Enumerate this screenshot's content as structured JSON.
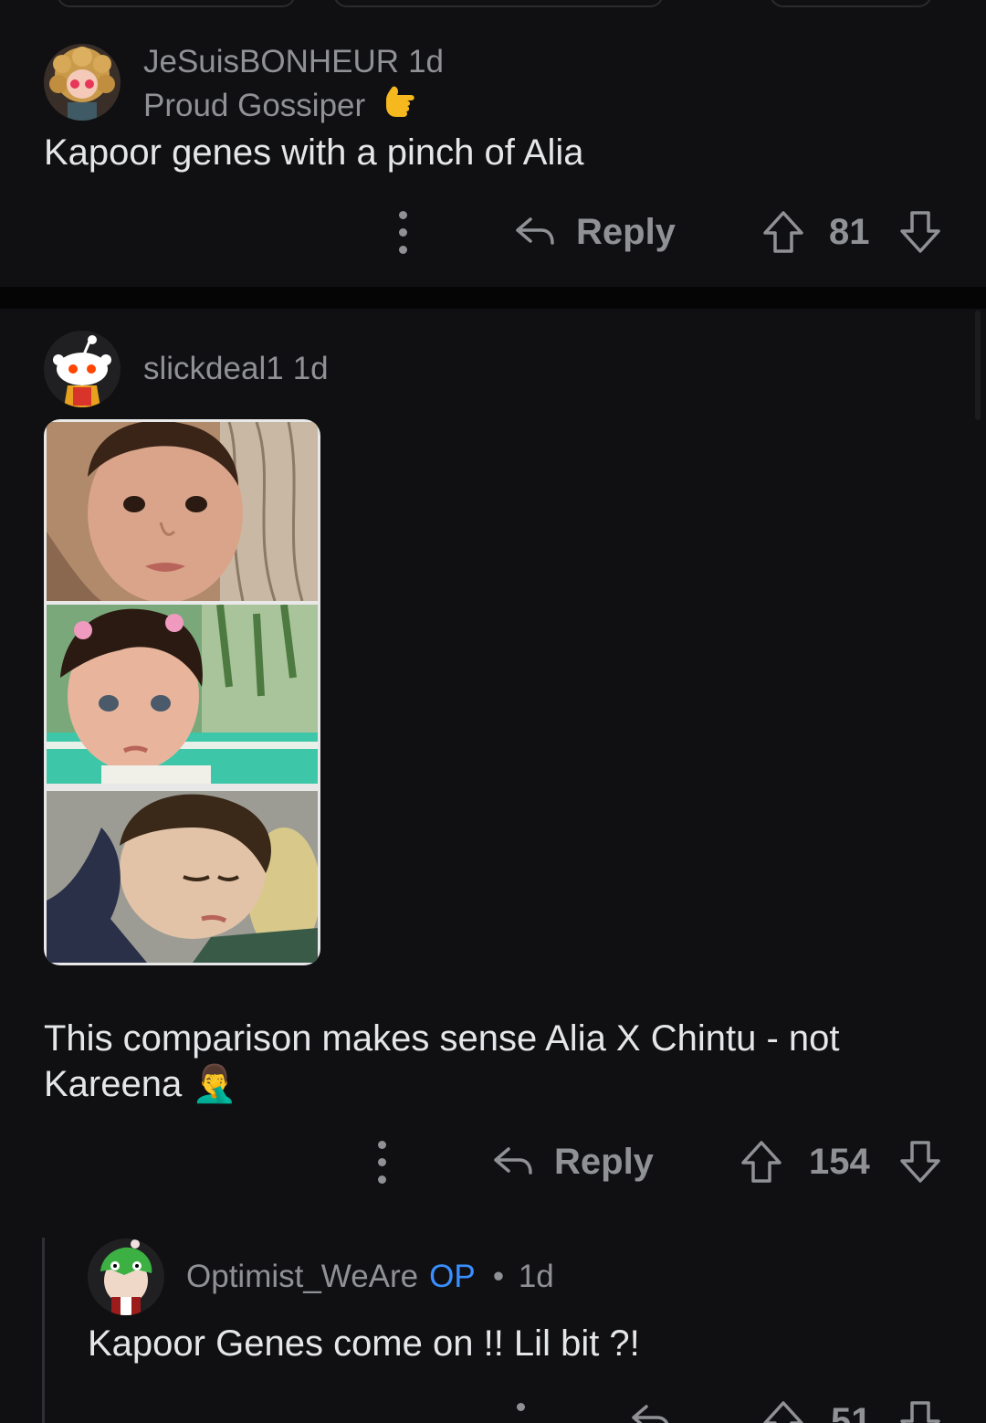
{
  "comments": [
    {
      "username": "JeSuisBONHEUR",
      "time": "1d",
      "flair": "Proud Gossiper",
      "text": "Kapoor genes with a pinch of Alia",
      "reply_label": "Reply",
      "score": "81"
    },
    {
      "username": "slickdeal1",
      "time": "1d",
      "text": "This comparison makes sense Alia X Chintu - not Kareena 🤦‍♂️",
      "reply_label": "Reply",
      "score": "154"
    },
    {
      "username": "Optimist_WeAre",
      "op_badge": "OP",
      "separator": "•",
      "time": "1d",
      "text": "Kapoor Genes come on !! Lil bit ?!",
      "score": "51"
    }
  ],
  "colors": {
    "background": "#101012",
    "muted": "#8f9195",
    "op_badge": "#3a8fff",
    "text": "#e4e6e8"
  }
}
